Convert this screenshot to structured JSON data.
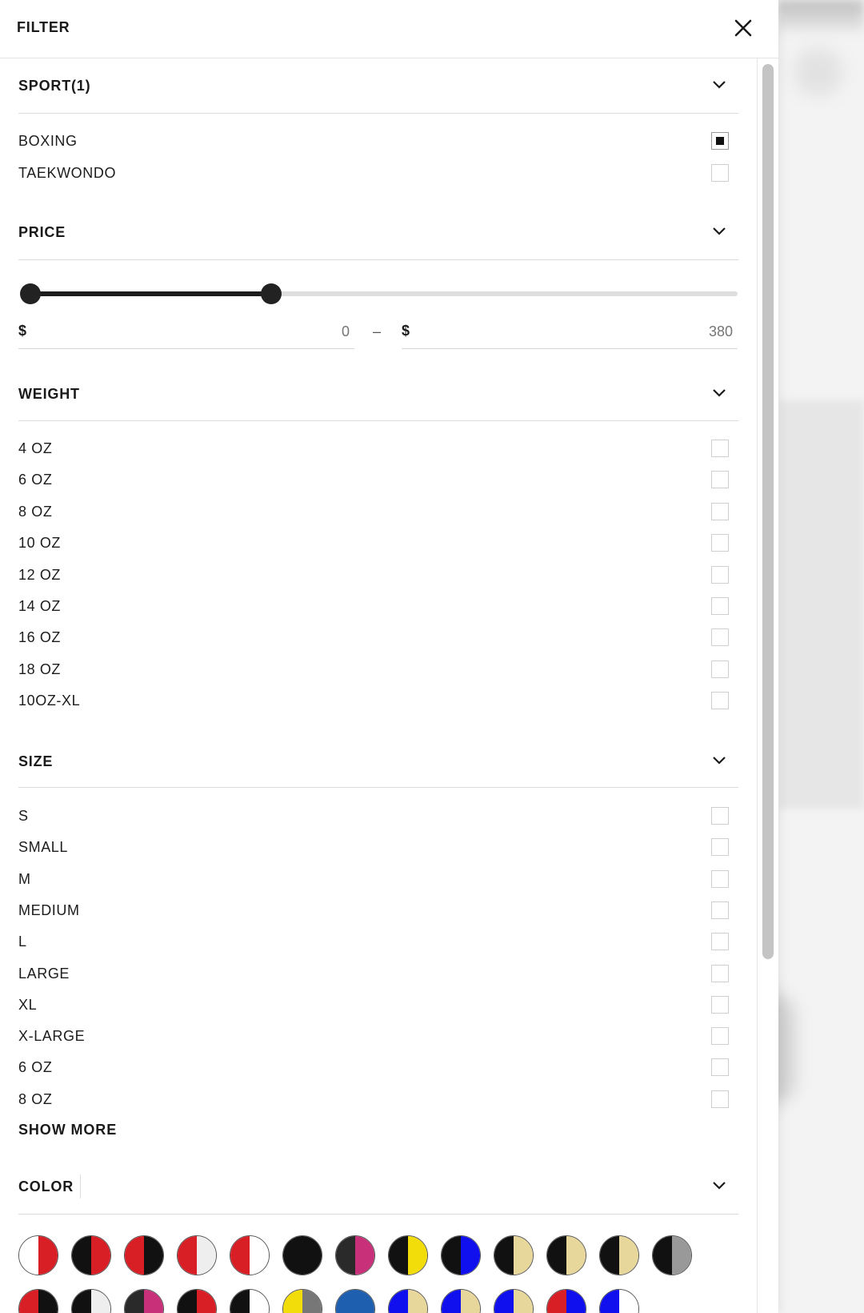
{
  "header": {
    "title": "FILTER"
  },
  "sections": {
    "sport": {
      "title": "SPORT(1)",
      "options": [
        {
          "label": "BOXING",
          "checked": true
        },
        {
          "label": "TAEKWONDO",
          "checked": false
        }
      ]
    },
    "price": {
      "title": "PRICE",
      "currency": "$",
      "min_value": "0",
      "max_value": "380",
      "separator": "–",
      "selected_range_fraction": [
        0.0,
        0.34
      ]
    },
    "weight": {
      "title": "WEIGHT",
      "options": [
        {
          "label": "4 OZ",
          "checked": false
        },
        {
          "label": "6 OZ",
          "checked": false
        },
        {
          "label": "8 OZ",
          "checked": false
        },
        {
          "label": "10 OZ",
          "checked": false
        },
        {
          "label": "12 OZ",
          "checked": false
        },
        {
          "label": "14 OZ",
          "checked": false
        },
        {
          "label": "16 OZ",
          "checked": false
        },
        {
          "label": "18 OZ",
          "checked": false
        },
        {
          "label": "10OZ-XL",
          "checked": false
        }
      ]
    },
    "size": {
      "title": "SIZE",
      "options": [
        {
          "label": "S",
          "checked": false
        },
        {
          "label": "SMALL",
          "checked": false
        },
        {
          "label": "M",
          "checked": false
        },
        {
          "label": "MEDIUM",
          "checked": false
        },
        {
          "label": "L",
          "checked": false
        },
        {
          "label": "LARGE",
          "checked": false
        },
        {
          "label": "XL",
          "checked": false
        },
        {
          "label": "X-LARGE",
          "checked": false
        },
        {
          "label": "6 OZ",
          "checked": false
        },
        {
          "label": "8 OZ",
          "checked": false
        }
      ],
      "show_more_label": "SHOW MORE"
    },
    "color": {
      "title": "COLOR",
      "swatches_row1": [
        [
          "#ffffff",
          "#d91f26"
        ],
        [
          "#111111",
          "#d91f26"
        ],
        [
          "#d91f26",
          "#111111"
        ],
        [
          "#d91f26",
          "#eeeeee"
        ],
        [
          "#d91f26",
          "#ffffff"
        ],
        [
          "#111111",
          "#111111"
        ],
        [
          "#2a2a2a",
          "#c8317a"
        ],
        [
          "#111111",
          "#f2dc0a"
        ],
        [
          "#111111",
          "#1010ee"
        ],
        [
          "#111111",
          "#e8d79a"
        ],
        [
          "#111111",
          "#e8d79a"
        ],
        [
          "#111111",
          "#e8d79a"
        ],
        [
          "#111111",
          "#999999"
        ]
      ],
      "swatches_row2": [
        [
          "#d91f26",
          "#111111"
        ],
        [
          "#111111",
          "#eeeeee"
        ],
        [
          "#2a2a2a",
          "#c8317a"
        ],
        [
          "#111111",
          "#d91f26"
        ],
        [
          "#111111",
          "#ffffff"
        ],
        [
          "#f2dc0a",
          "#777777"
        ],
        [
          "#1e5fb0",
          "#1e5fb0"
        ],
        [
          "#1010ee",
          "#e8d79a"
        ],
        [
          "#1010ee",
          "#e8d79a"
        ],
        [
          "#1010ee",
          "#e8d79a"
        ],
        [
          "#d91f26",
          "#1010ee"
        ],
        [
          "#1010ee",
          "#ffffff"
        ]
      ]
    }
  },
  "colors": {
    "accent": "#111111",
    "divider": "#dcdcdc",
    "muted_text": "#a8a8a8"
  }
}
